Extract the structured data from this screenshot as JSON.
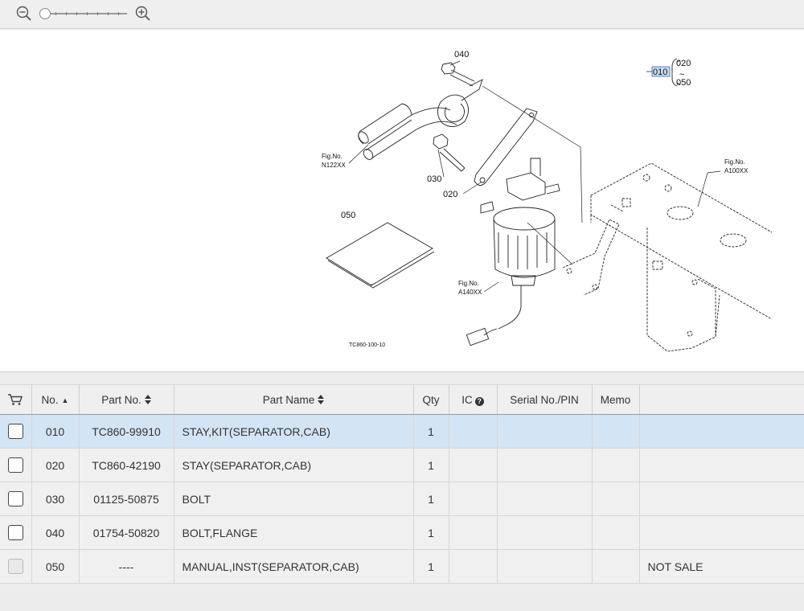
{
  "toolbar": {
    "zoom_out_icon": "zoom-out-icon",
    "zoom_in_icon": "zoom-in-icon",
    "zoom_level_fraction": 0
  },
  "diagram": {
    "callouts": [
      "040",
      "030",
      "020",
      "050"
    ],
    "fig_refs": [
      {
        "line1": "Fig.No.",
        "line2": "N122XX"
      },
      {
        "line1": "Fig.No.",
        "line2": "A100XX"
      },
      {
        "line1": "Fig.No.",
        "line2": "A140XX"
      }
    ],
    "legend": {
      "selected": "010",
      "from": "020",
      "tilde": "~",
      "to": "050"
    },
    "drawing_code": "TC860-100-10"
  },
  "table": {
    "headers": {
      "cart_icon": "cart-icon",
      "no": "No.",
      "part_no": "Part No.",
      "part_name": "Part Name",
      "qty": "Qty",
      "ic": "IC",
      "serial": "Serial No./PIN",
      "memo": "Memo"
    },
    "rows": [
      {
        "no": "010",
        "part_no": "TC860-99910",
        "part_name": "STAY,KIT(SEPARATOR,CAB)",
        "qty": "1",
        "ic": "",
        "serial": "",
        "memo": "",
        "extra": "",
        "selected": true,
        "disabled": false
      },
      {
        "no": "020",
        "part_no": "TC860-42190",
        "part_name": "STAY(SEPARATOR,CAB)",
        "qty": "1",
        "ic": "",
        "serial": "",
        "memo": "",
        "extra": "",
        "selected": false,
        "disabled": false
      },
      {
        "no": "030",
        "part_no": "01125-50875",
        "part_name": "BOLT",
        "qty": "1",
        "ic": "",
        "serial": "",
        "memo": "",
        "extra": "",
        "selected": false,
        "disabled": false
      },
      {
        "no": "040",
        "part_no": "01754-50820",
        "part_name": "BOLT,FLANGE",
        "qty": "1",
        "ic": "",
        "serial": "",
        "memo": "",
        "extra": "",
        "selected": false,
        "disabled": false
      },
      {
        "no": "050",
        "part_no": "----",
        "part_name": "MANUAL,INST(SEPARATOR,CAB)",
        "qty": "1",
        "ic": "",
        "serial": "",
        "memo": "",
        "extra": "NOT SALE",
        "selected": false,
        "disabled": true
      }
    ]
  }
}
